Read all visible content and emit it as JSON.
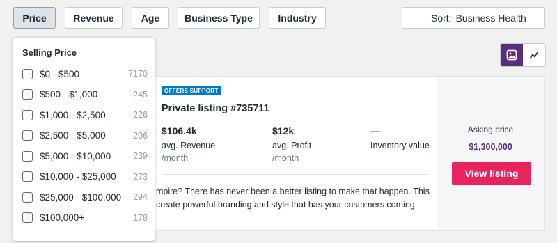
{
  "filters": [
    {
      "label": "Price",
      "active": true
    },
    {
      "label": "Revenue",
      "active": false
    },
    {
      "label": "Age",
      "active": false
    },
    {
      "label": "Business Type",
      "active": false
    },
    {
      "label": "Industry",
      "active": false
    }
  ],
  "sort": {
    "label": "Sort:",
    "value": "Business Health"
  },
  "view_toggle": {
    "options": [
      "gallery-icon",
      "chart-icon"
    ],
    "selected": "gallery-icon"
  },
  "dropdown": {
    "title": "Selling Price",
    "options": [
      {
        "label": "$0 - $500",
        "count": "7170"
      },
      {
        "label": "$500 - $1,000",
        "count": "245"
      },
      {
        "label": "$1,000 - $2,500",
        "count": "226"
      },
      {
        "label": "$2,500 - $5,000",
        "count": "206"
      },
      {
        "label": "$5,000 - $10,000",
        "count": "239"
      },
      {
        "label": "$10,000 - $25,000",
        "count": "273"
      },
      {
        "label": "$25,000 - $100,000",
        "count": "294"
      },
      {
        "label": "$100,000+",
        "count": "178"
      }
    ]
  },
  "listing": {
    "badge": "OFFERS SUPPORT",
    "title": "Private listing #735711",
    "metrics": [
      {
        "value": "$106.4k",
        "label": "avg. Revenue",
        "unit": "/month"
      },
      {
        "value": "$12k",
        "label": "avg. Profit",
        "unit": "/month"
      },
      {
        "value": "—",
        "label": "Inventory value",
        "unit": ""
      }
    ],
    "description_lines": [
      "mpire? There has never been a better listing to make that happen. This",
      "create powerful branding and style that has your customers coming"
    ],
    "asking_label": "Asking price",
    "asking_price": "$1,300,000",
    "view_button": "View listing"
  },
  "colors": {
    "accent_purple": "#5c2d7f",
    "cta_pink": "#e8245d",
    "badge_blue": "#007ace"
  }
}
